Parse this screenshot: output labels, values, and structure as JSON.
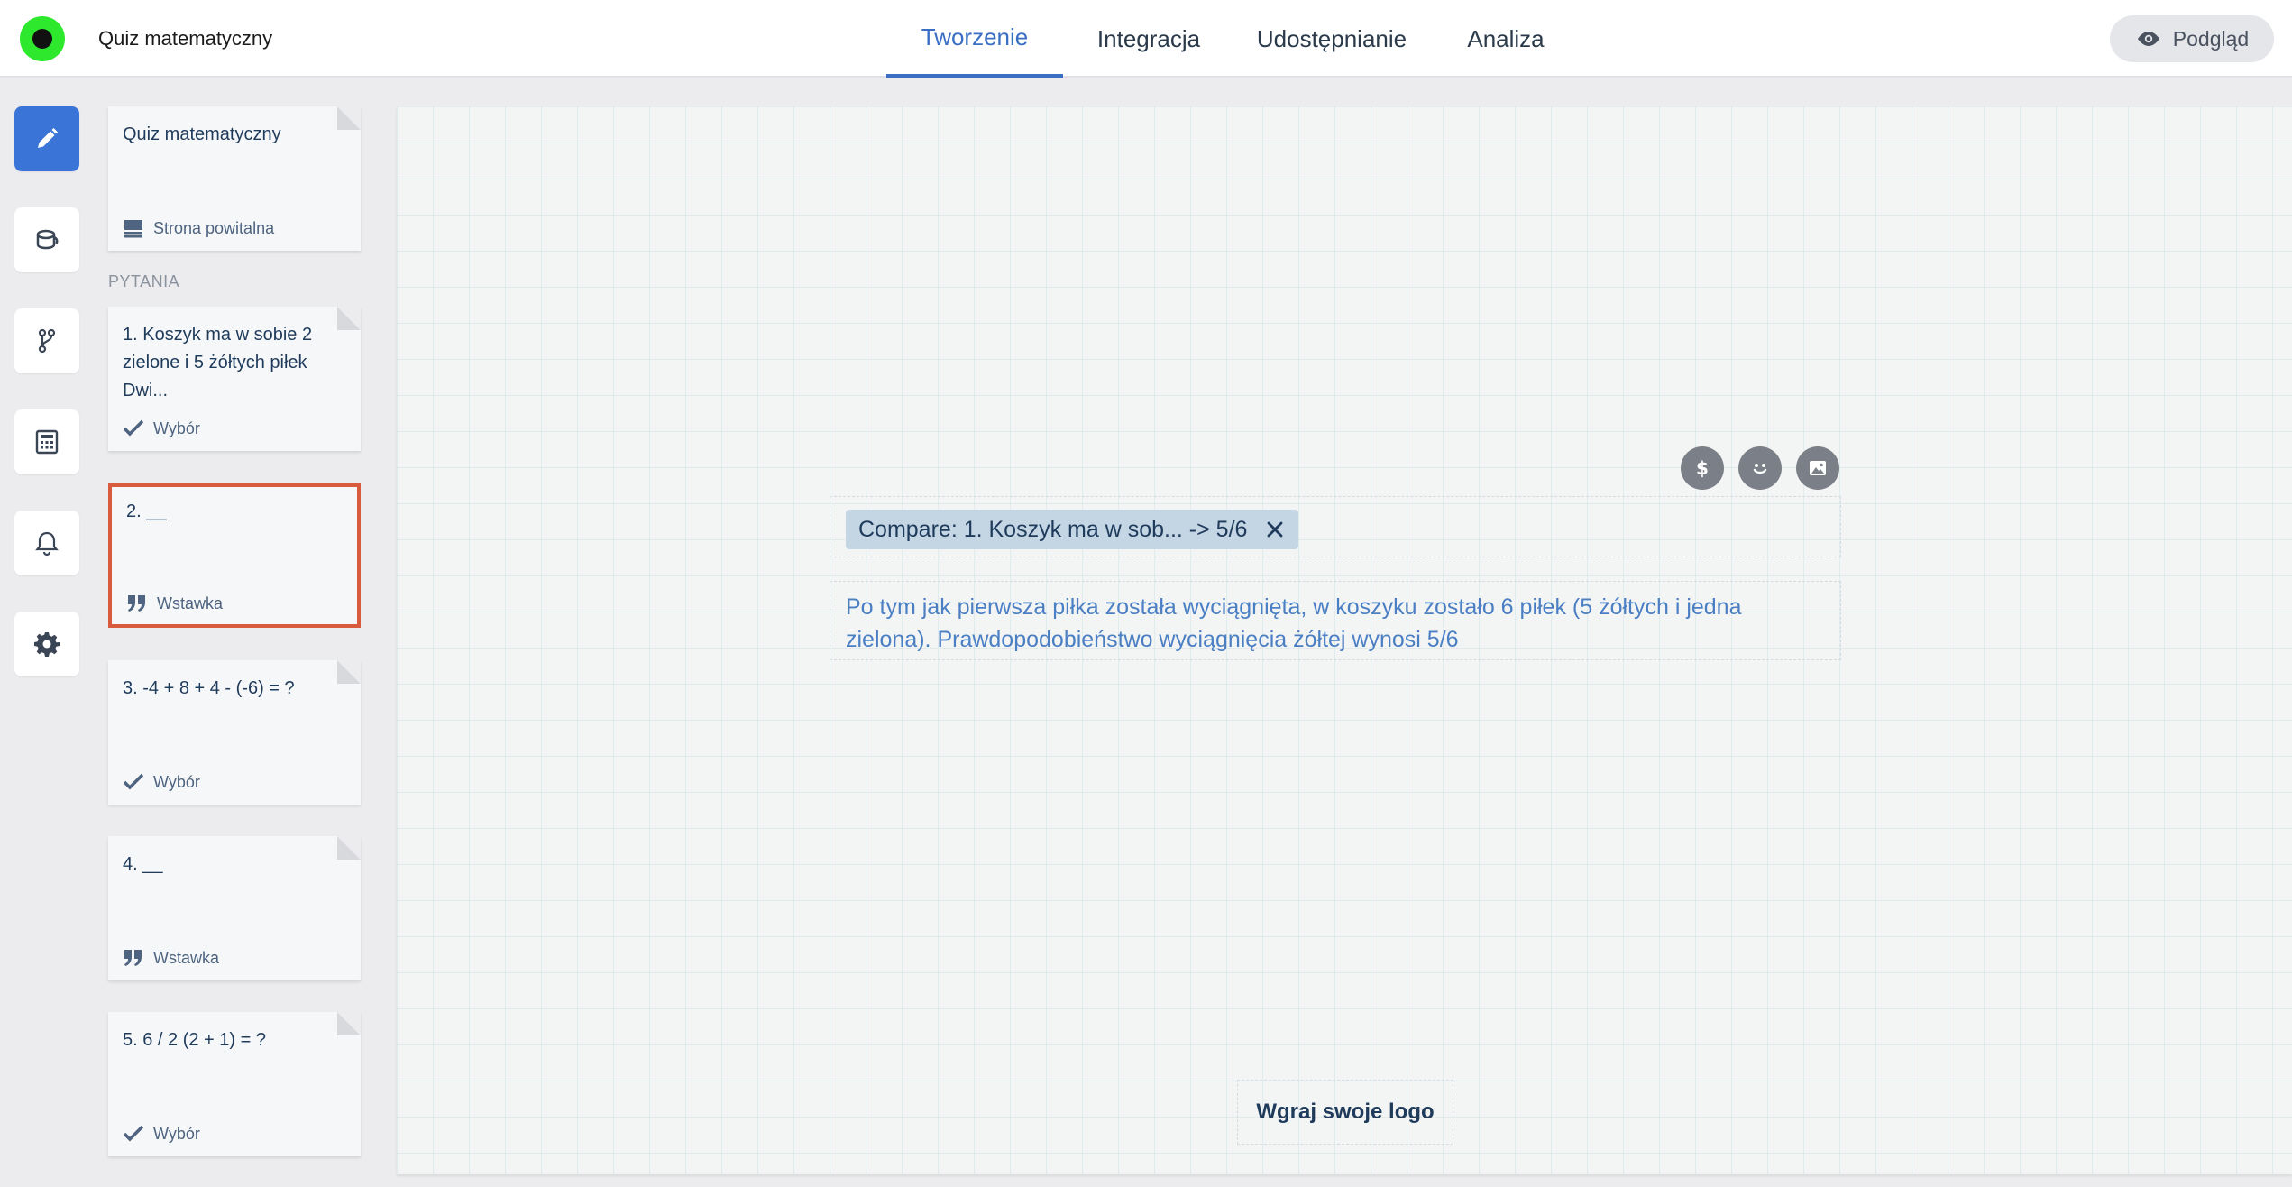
{
  "app": {
    "title": "Quiz matematyczny"
  },
  "tabs": [
    {
      "label": "Tworzenie",
      "active": true
    },
    {
      "label": "Integracja",
      "active": false
    },
    {
      "label": "Udostępnianie",
      "active": false
    },
    {
      "label": "Analiza",
      "active": false
    }
  ],
  "preview": {
    "label": "Podgląd",
    "icon": "eye-icon"
  },
  "rail": [
    {
      "icon": "pencil-icon",
      "active": true
    },
    {
      "icon": "paint-bucket-icon",
      "active": false
    },
    {
      "icon": "branch-icon",
      "active": false
    },
    {
      "icon": "calculator-icon",
      "active": false
    },
    {
      "icon": "bell-icon",
      "active": false
    },
    {
      "icon": "gear-icon",
      "active": false
    }
  ],
  "welcome_card": {
    "title": "Quiz matematyczny",
    "type_label": "Strona powitalna",
    "type_icon": "welcome-page-icon"
  },
  "questions_section_label": "PYTANIA",
  "questions": [
    {
      "text": "1. Koszyk ma w sobie 2 zielone i 5 żółtych piłek Dwi...",
      "type_label": "Wybór",
      "type_icon": "checkmark-icon"
    },
    {
      "text": "2. __",
      "type_label": "Wstawka",
      "type_icon": "quote-icon",
      "selected": true
    },
    {
      "text": "3. -4 + 8 + 4 - (-6) = ?",
      "type_label": "Wybór",
      "type_icon": "checkmark-icon"
    },
    {
      "text": "4. __",
      "type_label": "Wstawka",
      "type_icon": "quote-icon"
    },
    {
      "text": "5. 6 / 2 (2 + 1) = ?",
      "type_label": "Wybór",
      "type_icon": "checkmark-icon"
    }
  ],
  "canvas": {
    "tool_icons": [
      "dollar-icon",
      "smiley-icon",
      "image-icon"
    ],
    "compare_chip": "Compare: 1. Koszyk ma w sob... -> 5/6",
    "answer_text": "Po tym jak pierwsza piłka została wyciągnięta, w koszyku zostało 6 piłek (5 żółtych i jedna zielona). Prawdopodobieństwo wyciągnięcia żółtej wynosi 5/6",
    "logo_upload_label": "Wgraj swoje logo"
  },
  "colors": {
    "accent": "#3a74d6",
    "selected_border": "#d95a3d",
    "logo_green": "#2ee82e",
    "answer_text": "#4b7fc4"
  }
}
